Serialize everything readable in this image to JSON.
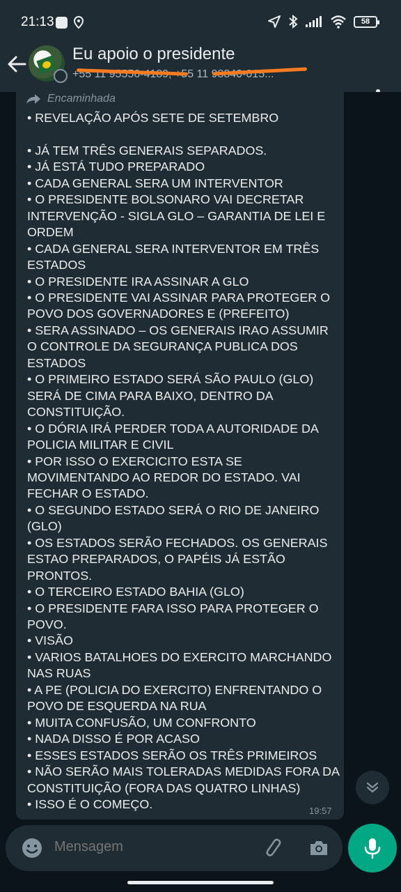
{
  "status_bar": {
    "time": "21:13",
    "battery": "58"
  },
  "header": {
    "title": "Eu apoio o presidente",
    "subtitle": "+55 11 95556-4189, +55 11 98840-015..."
  },
  "message": {
    "forwarded_label": "Encaminhada",
    "paragraphs": [
      "• REVELAÇÃO APÓS SETE DE SETEMBRO",
      "",
      "• JÁ TEM TRÊS GENERAIS SEPARADOS.",
      "• JÁ ESTÁ TUDO PREPARADO",
      "• CADA GENERAL SERA UM INTERVENTOR",
      "• O PRESIDENTE BOLSONARO VAI DECRETAR INTERVENÇÃO - SIGLA GLO – GARANTIA DE LEI E ORDEM",
      "• CADA GENERAL SERA INTERVENTOR EM TRÊS ESTADOS",
      "• O PRESIDENTE IRA ASSINAR A GLO",
      "• O PRESIDENTE VAI ASSINAR PARA PROTEGER O POVO DOS GOVERNADORES E (PREFEITO)",
      "• SERA ASSINADO – OS GENERAIS IRAO ASSUMIR O CONTROLE DA SEGURANÇA PUBLICA DOS ESTADOS",
      "• O PRIMEIRO ESTADO SERÁ SÃO PAULO (GLO) SERÁ DE CIMA PARA BAIXO, DENTRO DA CONSTITUIÇÃO.",
      "• O DÓRIA IRÁ PERDER TODA A AUTORIDADE DA POLICIA MILITAR E CIVIL",
      "• POR ISSO O EXERCICITO ESTA SE MOVIMENTANDO AO REDOR DO ESTADO. VAI FECHAR O ESTADO.",
      "• O SEGUNDO ESTADO SERÁ O RIO DE JANEIRO (GLO)",
      "• OS ESTADOS SERÃO FECHADOS. OS GENERAIS ESTAO PREPARADOS, O PAPÉIS JÁ ESTÃO PRONTOS.",
      "• O TERCEIRO ESTADO BAHIA (GLO)",
      "• O PRESIDENTE FARA ISSO PARA PROTEGER O POVO.",
      "• VISÃO",
      "• VARIOS BATALHOES DO EXERCITO MARCHANDO NAS RUAS",
      "• A PE (POLICIA DO EXERCITO) ENFRENTANDO O POVO DE ESQUERDA NA RUA",
      "• MUITA CONFUSÃO, UM CONFRONTO",
      "• NADA DISSO É POR ACASO",
      "• ESSES ESTADOS SERÃO OS TRÊS PRIMEIROS",
      "• NÃO SERÃO MAIS TOLERADAS MEDIDAS FORA DA CONSTITUIÇÃO (FORA DAS QUATRO LINHAS)",
      "• ISSO É O COMEÇO."
    ],
    "time": "19:57"
  },
  "composer": {
    "placeholder": "Mensagem"
  },
  "colors": {
    "header_bg": "#1f2c34",
    "chat_bg": "#0b141a",
    "bubble_bg": "#202c33",
    "accent": "#00a884",
    "redaction": "#f47b20"
  }
}
